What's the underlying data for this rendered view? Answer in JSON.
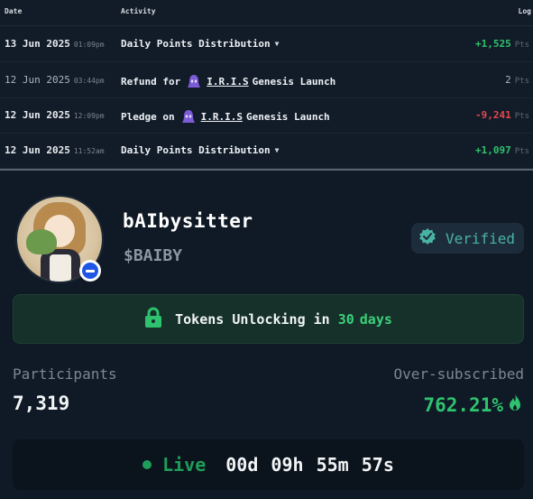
{
  "activity": {
    "columns": {
      "date": "Date",
      "activity": "Activity",
      "log": "Log"
    },
    "rows": [
      {
        "date": "13 Jun 2025",
        "time": "01:09pm",
        "action": "Daily Points Distribution",
        "has_dropdown": true,
        "points": "+1,525",
        "unit": "Pts",
        "kind": "positive",
        "dim": false
      },
      {
        "date": "12 Jun 2025",
        "time": "03:44pm",
        "action_prefix": "Refund for",
        "token": "I.R.I.S",
        "action_suffix": "Genesis Launch",
        "points": "2",
        "unit": "Pts",
        "kind": "neutral",
        "dim": true
      },
      {
        "date": "12 Jun 2025",
        "time": "12:09pm",
        "action_prefix": "Pledge on",
        "token": "I.R.I.S",
        "action_suffix": "Genesis Launch",
        "points": "-9,241",
        "unit": "Pts",
        "kind": "negative",
        "dim": false
      },
      {
        "date": "12 Jun 2025",
        "time": "11:52am",
        "action": "Daily Points Distribution",
        "has_dropdown": true,
        "points": "+1,097",
        "unit": "Pts",
        "kind": "positive",
        "dim": false
      }
    ]
  },
  "project": {
    "name": "bAIbysitter",
    "ticker": "$BAIBY",
    "verified_label": "Verified",
    "unlock": {
      "prefix": "Tokens Unlocking in",
      "days": "30",
      "days_word": "days"
    },
    "participants_label": "Participants",
    "participants_value": "7,319",
    "oversub_label": "Over-subscribed",
    "oversub_value": "762.21%",
    "live_label": "Live",
    "countdown": "00d 09h 55m 57s"
  },
  "colors": {
    "positive": "#2fc26e",
    "negative": "#e5484d",
    "accent_teal": "#49b3a3",
    "live_green": "#1e9e5a",
    "background": "#0f1a26"
  },
  "icons": {
    "dropdown": "chevron-down-icon",
    "token": "iris-token-icon",
    "verified": "verified-badge-icon",
    "lock": "lock-icon",
    "fire": "fire-icon",
    "avatar_badge": "minus-circle-icon"
  }
}
